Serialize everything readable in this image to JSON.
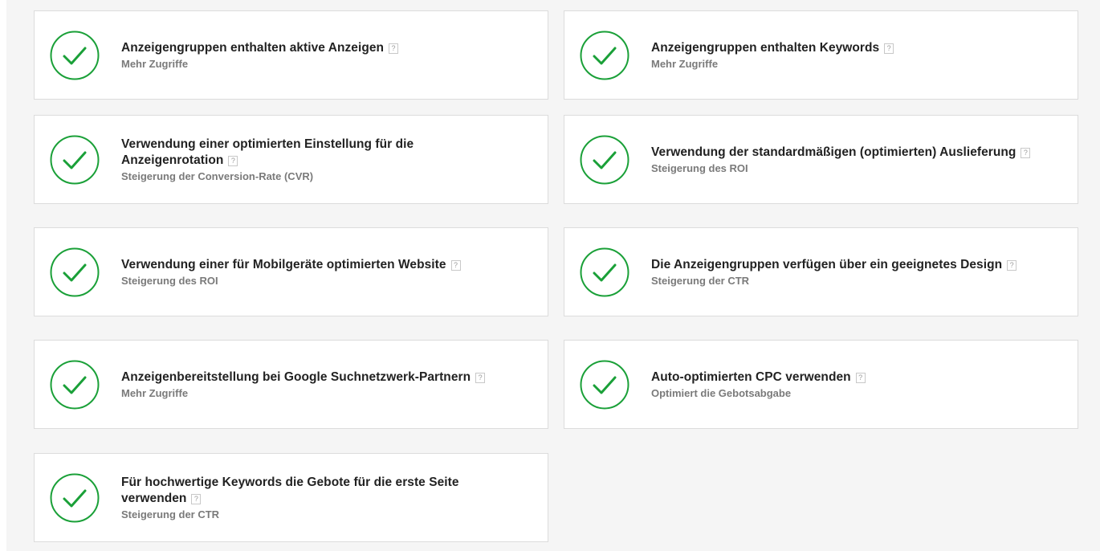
{
  "colors": {
    "check_green": "#1aa038",
    "title": "#222222",
    "subtitle": "#7a7a7a"
  },
  "help_label": "?",
  "cards": [
    {
      "title": "Anzeigengruppen enthalten aktive Anzeigen",
      "subtitle": "Mehr Zugriffe",
      "icon": "check-circle-icon",
      "status": "passed"
    },
    {
      "title": "Anzeigengruppen enthalten Keywords",
      "subtitle": "Mehr Zugriffe",
      "icon": "check-circle-icon",
      "status": "passed"
    },
    {
      "title": "Verwendung einer optimierten Einstellung für die Anzeigenrotation",
      "subtitle": "Steigerung der Conversion-Rate (CVR)",
      "icon": "check-circle-icon",
      "status": "passed"
    },
    {
      "title": "Verwendung der standardmäßigen (optimierten) Auslieferung",
      "subtitle": "Steigerung des ROI",
      "icon": "check-circle-icon",
      "status": "passed"
    },
    {
      "title": "Verwendung einer für Mobilgeräte optimierten Website",
      "subtitle": "Steigerung des ROI",
      "icon": "check-circle-icon",
      "status": "passed"
    },
    {
      "title": "Die Anzeigengruppen verfügen über ein geeignetes Design",
      "subtitle": "Steigerung der CTR",
      "icon": "check-circle-icon",
      "status": "passed"
    },
    {
      "title": "Anzeigenbereitstellung bei Google Suchnetzwerk-Partnern",
      "subtitle": "Mehr Zugriffe",
      "icon": "check-circle-icon",
      "status": "passed"
    },
    {
      "title": "Auto-optimierten CPC verwenden",
      "subtitle": "Optimiert die Gebotsabgabe",
      "icon": "check-circle-icon",
      "status": "passed"
    },
    {
      "title": "Für hochwertige Keywords die Gebote für die erste Seite verwenden",
      "subtitle": "Steigerung der CTR",
      "icon": "check-circle-icon",
      "status": "passed"
    }
  ]
}
